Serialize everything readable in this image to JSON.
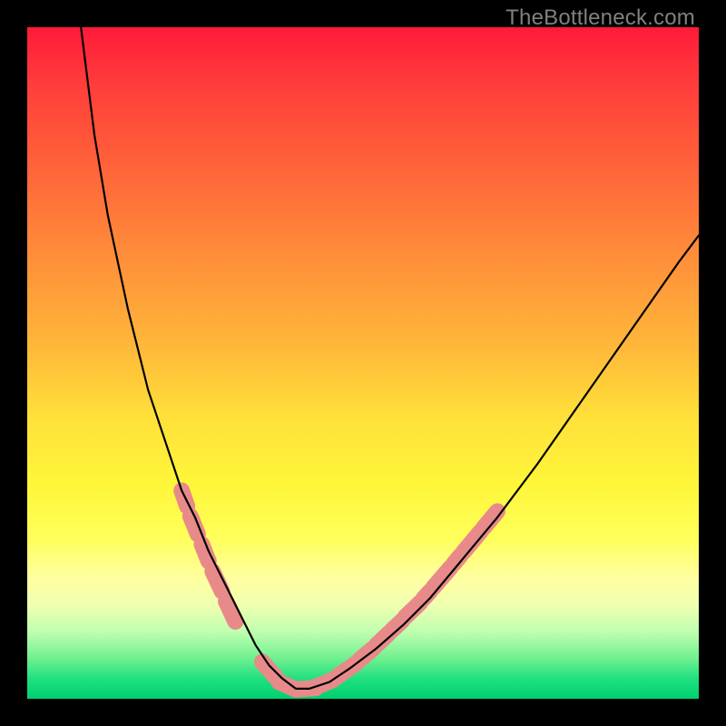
{
  "watermark": "TheBottleneck.com",
  "colors": {
    "background_frame": "#000000",
    "gradient_top": "#ff1a3a",
    "gradient_bottom": "#00d070",
    "curve_stroke": "#000000",
    "segments_stroke": "#e88a8a",
    "watermark_text": "#808080"
  },
  "chart_data": {
    "type": "line",
    "title": "",
    "xlabel": "",
    "ylabel": "",
    "xlim": [
      0,
      100
    ],
    "ylim": [
      0,
      100
    ],
    "grid": false,
    "legend_position": "none",
    "series": [
      {
        "name": "curve",
        "x": [
          8,
          10,
          12,
          15,
          18,
          21,
          23,
          25,
          27,
          29,
          31,
          33,
          34,
          36,
          38,
          40,
          42,
          45,
          48,
          52,
          56,
          60,
          65,
          70,
          76,
          83,
          90,
          97,
          100
        ],
        "y": [
          100,
          84,
          72,
          58,
          46,
          37,
          31,
          27,
          22,
          18,
          14,
          10,
          8,
          5,
          3,
          1.5,
          1.5,
          2.5,
          4.5,
          7.5,
          11,
          15,
          21,
          27,
          35,
          45,
          55,
          65,
          69
        ]
      }
    ],
    "highlight_segments": [
      {
        "x1": 23.0,
        "y1": 31.0,
        "x2": 23.8,
        "y2": 28.7
      },
      {
        "x1": 24.3,
        "y1": 27.2,
        "x2": 25.4,
        "y2": 24.5
      },
      {
        "x1": 26.0,
        "y1": 23.0,
        "x2": 27.0,
        "y2": 20.5
      },
      {
        "x1": 27.6,
        "y1": 19.0,
        "x2": 29.0,
        "y2": 16.0
      },
      {
        "x1": 29.6,
        "y1": 14.5,
        "x2": 31.0,
        "y2": 11.5
      },
      {
        "x1": 35.0,
        "y1": 5.5,
        "x2": 37.0,
        "y2": 3.2
      },
      {
        "x1": 37.5,
        "y1": 2.5,
        "x2": 40.0,
        "y2": 1.4
      },
      {
        "x1": 40.0,
        "y1": 1.4,
        "x2": 43.0,
        "y2": 1.6
      },
      {
        "x1": 43.0,
        "y1": 1.8,
        "x2": 45.5,
        "y2": 2.8
      },
      {
        "x1": 46.0,
        "y1": 3.2,
        "x2": 49.0,
        "y2": 5.3
      },
      {
        "x1": 49.5,
        "y1": 5.8,
        "x2": 51.5,
        "y2": 7.5
      },
      {
        "x1": 52.0,
        "y1": 8.0,
        "x2": 53.8,
        "y2": 9.7
      },
      {
        "x1": 54.3,
        "y1": 10.2,
        "x2": 55.8,
        "y2": 11.6
      },
      {
        "x1": 56.3,
        "y1": 12.2,
        "x2": 58.5,
        "y2": 14.3
      },
      {
        "x1": 59.0,
        "y1": 14.9,
        "x2": 60.0,
        "y2": 16.0
      },
      {
        "x1": 60.5,
        "y1": 16.6,
        "x2": 63.0,
        "y2": 19.5
      },
      {
        "x1": 63.5,
        "y1": 20.1,
        "x2": 64.5,
        "y2": 21.3
      },
      {
        "x1": 65.0,
        "y1": 21.9,
        "x2": 67.5,
        "y2": 24.9
      },
      {
        "x1": 68.0,
        "y1": 25.5,
        "x2": 70.0,
        "y2": 27.9
      }
    ],
    "annotations": [
      {
        "text": "TheBottleneck.com",
        "x": 98,
        "y": 101,
        "anchor": "top-right"
      }
    ]
  }
}
